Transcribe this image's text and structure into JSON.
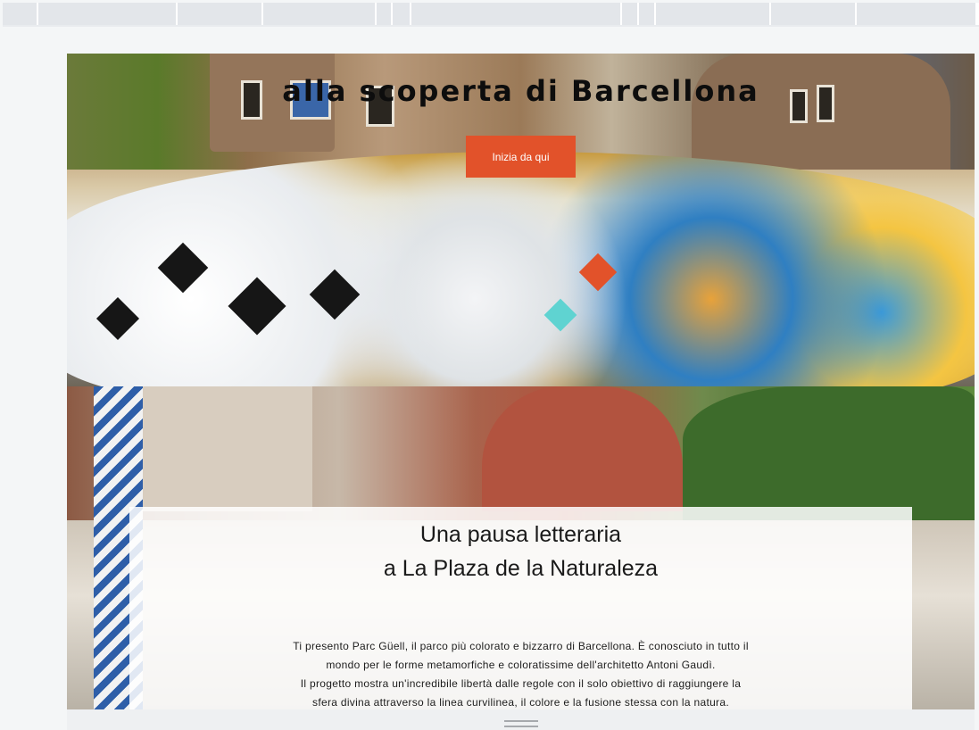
{
  "topbar": {
    "segments": [
      {
        "w": 40
      },
      {
        "w": 156
      },
      {
        "w": 96
      },
      {
        "w": 127
      },
      {
        "w": 18
      },
      {
        "w": 21
      },
      {
        "w": 236
      },
      {
        "w": 19
      },
      {
        "w": 19
      },
      {
        "w": 129
      },
      {
        "w": 96
      },
      {
        "w": 135
      }
    ]
  },
  "hero": {
    "title": "alla scoperta di Barcellona",
    "cta_label": "Inizia da qui",
    "colors": {
      "cta": "#e2522a"
    }
  },
  "section2": {
    "heading_line1": "Una pausa letteraria",
    "heading_line2": "a La Plaza de la Naturaleza",
    "body_lines": [
      "Ti presento Parc Güell, il parco più colorato e bizzarro di Barcellona. È conosciuto in tutto il",
      "mondo per le forme metamorfiche e coloratissime dell'architetto Antoni Gaudì.",
      "Il progetto mostra un'incredibile libertà dalle regole con il solo obiettivo di raggiungere la",
      "sfera divina attraverso la linea curvilinea, il colore e la fusione stessa con la natura."
    ]
  }
}
